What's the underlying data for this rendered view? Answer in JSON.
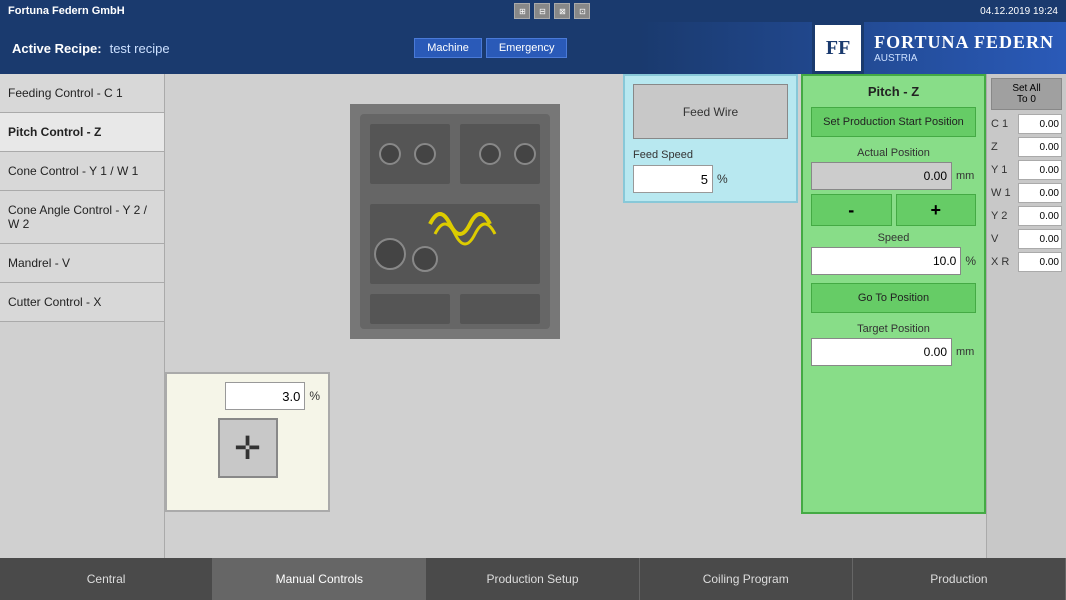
{
  "titlebar": {
    "company": "Fortuna Federn GmbH",
    "datetime": "04.12.2019 19:24"
  },
  "header": {
    "active_recipe_label": "Active Recipe:",
    "recipe_name": "test recipe",
    "logo_ff": "FF",
    "logo_company": "FORTUNA FEDERN",
    "logo_country": "AUSTRIA",
    "nav_machine": "Machine",
    "nav_emergency": "Emergency"
  },
  "sidebar": {
    "items": [
      {
        "id": "feeding",
        "label": "Feeding Control - C 1"
      },
      {
        "id": "pitch",
        "label": "Pitch Control - Z"
      },
      {
        "id": "cone",
        "label": "Cone Control - Y 1 / W 1"
      },
      {
        "id": "cone_angle",
        "label": "Cone Angle Control - Y 2 / W 2"
      },
      {
        "id": "mandrel",
        "label": "Mandrel - V"
      },
      {
        "id": "cutter",
        "label": "Cutter Control - X"
      }
    ]
  },
  "cutter_panel": {
    "value": "3.0",
    "unit": "%"
  },
  "feed_panel": {
    "feed_wire_label": "Feed Wire",
    "feed_speed_label": "Feed Speed",
    "feed_speed_value": "5",
    "feed_speed_unit": "%"
  },
  "pitch_panel": {
    "title": "Pitch - Z",
    "set_start_btn": "Set Production Start Position",
    "actual_position_label": "Actual Position",
    "actual_position_value": "0.00",
    "actual_position_unit": "mm",
    "minus_btn": "-",
    "plus_btn": "+",
    "speed_label": "Speed",
    "speed_value": "10.0",
    "speed_unit": "%",
    "go_to_btn": "Go To Position",
    "target_label": "Target Position",
    "target_value": "0.00",
    "target_unit": "mm"
  },
  "right_panel": {
    "set_all_label": "Set All",
    "to_0_label": "To 0",
    "axes": [
      {
        "label": "C 1",
        "value": "0.00"
      },
      {
        "label": "Z",
        "value": "0.00"
      },
      {
        "label": "Y 1",
        "value": "0.00"
      },
      {
        "label": "W 1",
        "value": "0.00"
      },
      {
        "label": "Y 2",
        "value": "0.00"
      },
      {
        "label": "V",
        "value": "0.00"
      },
      {
        "label": "X R",
        "value": "0.00"
      }
    ]
  },
  "navbar": {
    "tabs": [
      {
        "id": "central",
        "label": "Central"
      },
      {
        "id": "manual",
        "label": "Manual Controls",
        "active": true
      },
      {
        "id": "production_setup",
        "label": "Production Setup"
      },
      {
        "id": "coiling",
        "label": "Coiling Program"
      },
      {
        "id": "production",
        "label": "Production"
      }
    ]
  }
}
